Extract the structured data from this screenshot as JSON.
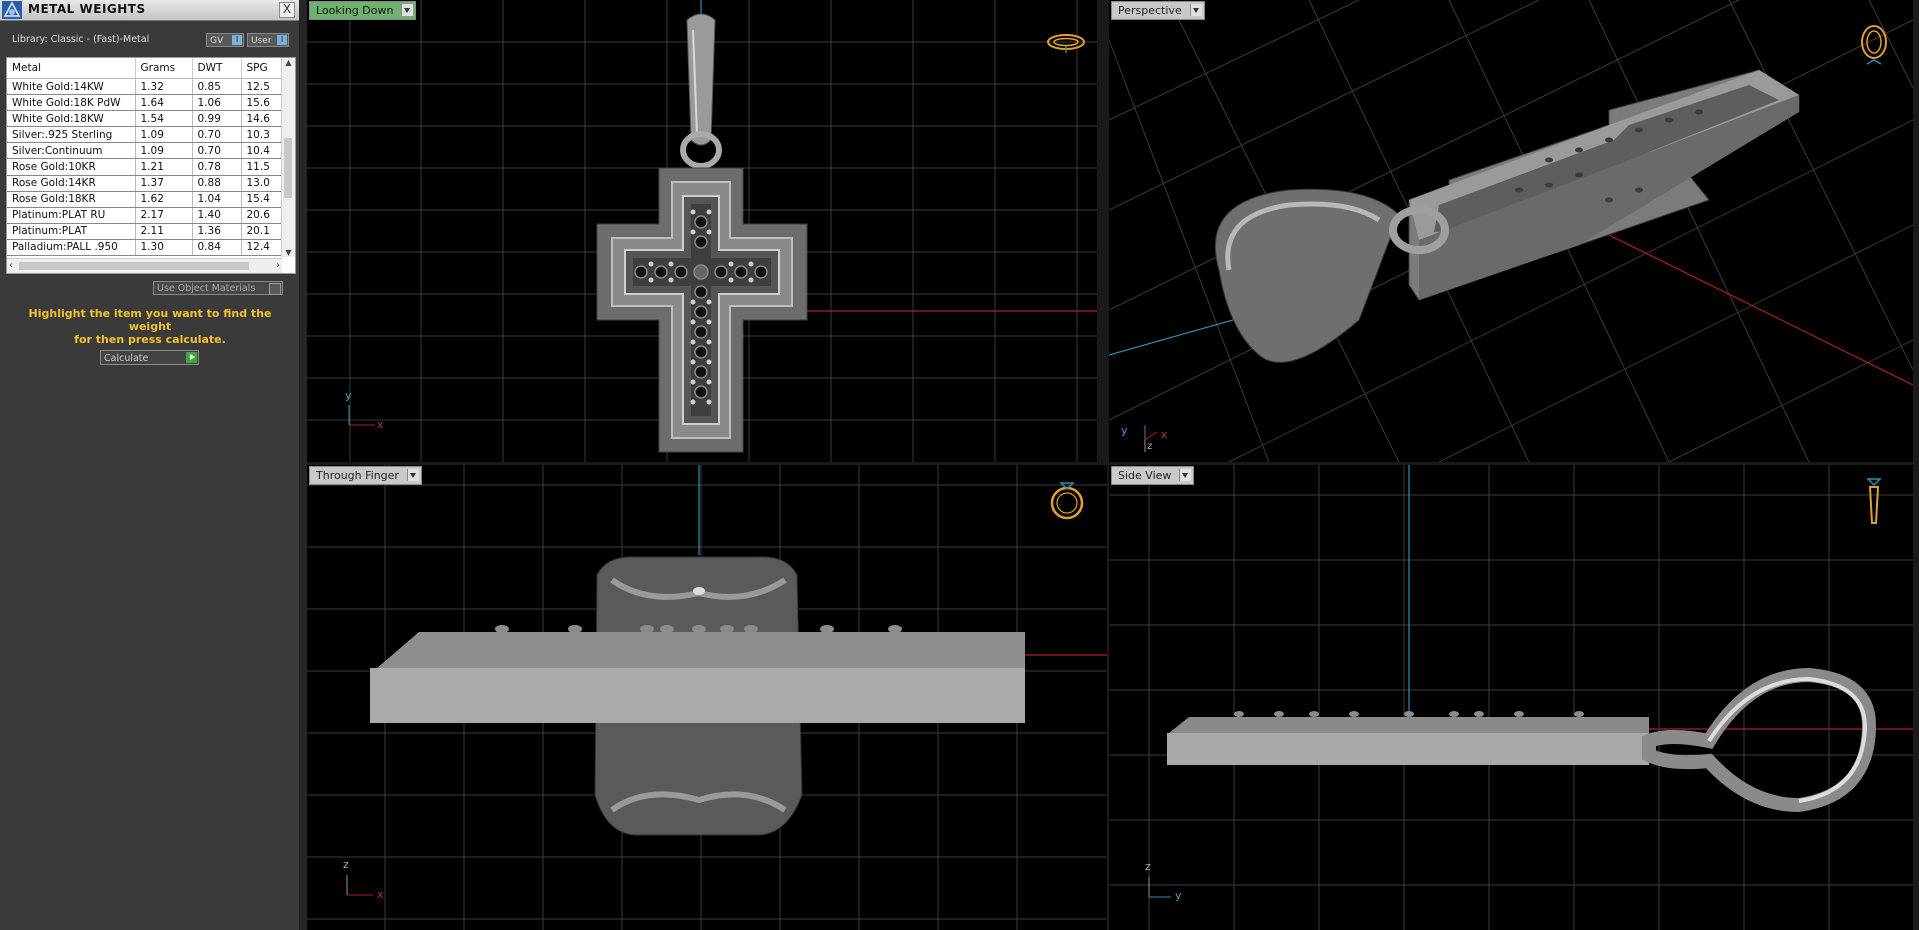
{
  "panel": {
    "title": "METAL WEIGHTS",
    "close_label": "X",
    "library_label": "Library: Classic - (Fast)-Metal",
    "gv_label": "GV",
    "user_label": "User",
    "toggle_glyph": "I",
    "columns": [
      "Metal",
      "Grams",
      "DWT",
      "SPG"
    ],
    "rows": [
      [
        "White Gold:14KW",
        "1.32",
        "0.85",
        "12.5"
      ],
      [
        "White Gold:18K PdW",
        "1.64",
        "1.06",
        "15.6"
      ],
      [
        "White Gold:18KW",
        "1.54",
        "0.99",
        "14.6"
      ],
      [
        "Silver:.925 Sterling",
        "1.09",
        "0.70",
        "10.3"
      ],
      [
        "Silver:Continuum",
        "1.09",
        "0.70",
        "10.4"
      ],
      [
        "Rose Gold:10KR",
        "1.21",
        "0.78",
        "11.5"
      ],
      [
        "Rose Gold:14KR",
        "1.37",
        "0.88",
        "13.0"
      ],
      [
        "Rose Gold:18KR",
        "1.62",
        "1.04",
        "15.4"
      ],
      [
        "Platinum:PLAT RU",
        "2.17",
        "1.40",
        "20.6"
      ],
      [
        "Platinum:PLAT",
        "2.11",
        "1.36",
        "20.1"
      ],
      [
        "Palladium:PALL .950",
        "1.30",
        "0.84",
        "12.4"
      ]
    ],
    "use_object_materials": "Use Object Materials",
    "hint_line1": "Highlight the item you want to find the weight",
    "hint_line2": "for then press calculate.",
    "calculate_label": "Calculate"
  },
  "viewports": {
    "top": {
      "label": "Looking Down",
      "axis_v": "y",
      "axis_h": "x"
    },
    "perspective": {
      "label": "Perspective",
      "axis_v": "y",
      "axis_h": "x",
      "axis_d": "z"
    },
    "front": {
      "label": "Through Finger",
      "axis_v": "z",
      "axis_h": "x"
    },
    "side": {
      "label": "Side View",
      "axis_v": "z",
      "axis_h": "y"
    }
  },
  "colors": {
    "grid": "#3a3a3a",
    "axis_red": "#b02020",
    "axis_blue": "#2f8fb0",
    "active_tab": "#6fb26f",
    "hint": "#f2c230",
    "icon_gold": "#e0a030"
  }
}
